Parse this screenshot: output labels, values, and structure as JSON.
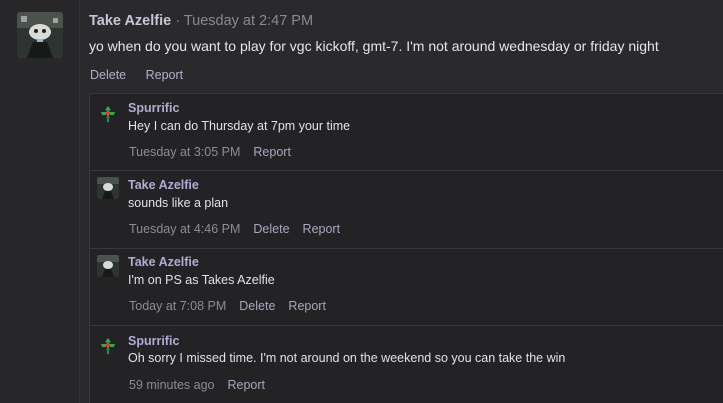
{
  "post": {
    "author": "Take Azelfie",
    "separator": " · ",
    "time": "Tuesday at 2:47 PM",
    "body": "yo when do you want to play for vgc kickoff, gmt-7. I'm not around wednesday or friday night",
    "actions": {
      "delete": "Delete",
      "report": "Report"
    }
  },
  "comments": [
    {
      "author": "Spurrific",
      "text": "Hey I can do Thursday at 7pm your time",
      "time": "Tuesday at 3:05 PM",
      "delete": "",
      "report": "Report",
      "avatar": "flower-icon"
    },
    {
      "author": "Take Azelfie",
      "text": "sounds like a plan",
      "time": "Tuesday at 4:46 PM",
      "delete": "Delete",
      "report": "Report",
      "avatar": "user-avatar"
    },
    {
      "author": "Take Azelfie",
      "text": "I'm on PS as Takes Azelfie",
      "time": "Today at 7:08 PM",
      "delete": "Delete",
      "report": "Report",
      "avatar": "user-avatar"
    },
    {
      "author": "Spurrific",
      "text": "Oh sorry I missed time. I'm not around on the weekend so you can take the win",
      "time": "59 minutes ago",
      "delete": "",
      "report": "Report",
      "avatar": "flower-icon"
    }
  ],
  "colors": {
    "author": "#b3abd3",
    "link": "#aaa6c0",
    "flower_green": "#3fa34d",
    "flower_red": "#d8433b"
  }
}
